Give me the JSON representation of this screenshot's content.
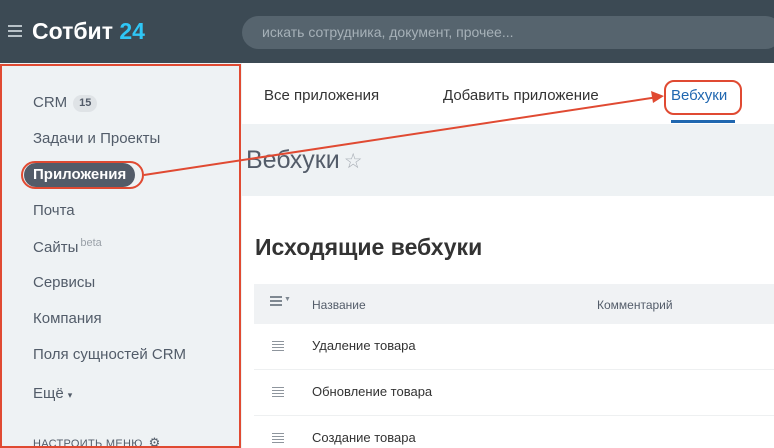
{
  "header": {
    "logo_text": "Сотбит",
    "logo_number": "24",
    "search_placeholder": "искать сотрудника, документ, прочее..."
  },
  "sidebar": {
    "items": [
      {
        "label": "CRM",
        "badge": "15"
      },
      {
        "label": "Задачи и Проекты"
      },
      {
        "label": "Приложения",
        "active": true
      },
      {
        "label": "Почта"
      },
      {
        "label": "Сайты",
        "sup": "beta"
      },
      {
        "label": "Сервисы"
      },
      {
        "label": "Компания"
      },
      {
        "label": "Поля сущностей CRM"
      },
      {
        "label": "Ещё"
      }
    ],
    "configure_label": "НАСТРОИТЬ МЕНЮ"
  },
  "tabs": [
    {
      "label": "Все приложения"
    },
    {
      "label": "Добавить приложение"
    },
    {
      "label": "Вебхуки",
      "active": true
    }
  ],
  "page": {
    "title": "Вебхуки",
    "section_title": "Исходящие вебхуки"
  },
  "grid": {
    "columns": [
      "Название",
      "Комментарий"
    ],
    "rows": [
      {
        "name": "Удаление товара"
      },
      {
        "name": "Обновление товара"
      },
      {
        "name": "Создание товара"
      }
    ]
  },
  "colors": {
    "header_bg": "#3c4a54",
    "accent": "#2067b0",
    "annotation": "#e04a32",
    "logo_accent": "#2fc6f6"
  }
}
